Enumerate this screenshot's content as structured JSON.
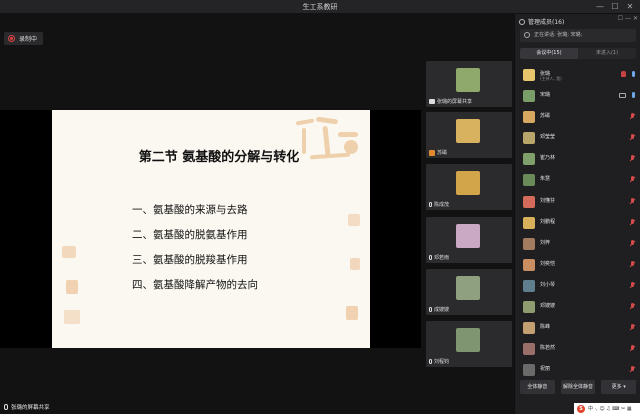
{
  "window": {
    "title": "生工系教研",
    "controls": {
      "minimize": "—",
      "maximize": "☐",
      "close": "✕"
    }
  },
  "recording": {
    "label": "录制中"
  },
  "slide": {
    "title": "第二节  氨基酸的分解与转化",
    "items": [
      "一、氨基酸的来源与去路",
      "二、氨基酸的脱氨基作用",
      "三、氨基酸的脱羧基作用",
      "四、氨基酸降解产物的去向"
    ],
    "watermark": "吉祥如意"
  },
  "share_label": "张璐的屏幕共享",
  "tiles": [
    {
      "name": "张璐的屏幕共享",
      "color": "#8fa86c",
      "badge": "screen"
    },
    {
      "name": "苏磁",
      "color": "#d9b25f",
      "badge": "host"
    },
    {
      "name": "陈成茂",
      "color": "#d2a54a",
      "badge": "none"
    },
    {
      "name": "邓若雨",
      "color": "#c9a9c4",
      "badge": "none"
    },
    {
      "name": "成嫂嫂",
      "color": "#8ea07f",
      "badge": "none"
    },
    {
      "name": "刘程钧",
      "color": "#7f9470",
      "badge": "none"
    }
  ],
  "panel": {
    "title": "管理成员(16)",
    "search_placeholder": "正在讲话: 张璐; 宋璐;",
    "tabs": [
      "会议中(15)",
      "未进入(1)"
    ],
    "participants": [
      {
        "name": "张璐",
        "sub": "(主持人, 我)",
        "color": "#e7c56b",
        "icons": [
          "hand",
          "mic-on"
        ]
      },
      {
        "name": "宋璐",
        "sub": "",
        "color": "#7a9e6a",
        "icons": [
          "cam",
          "mic-on"
        ]
      },
      {
        "name": "苏磁",
        "sub": "",
        "color": "#d8a860",
        "icons": [
          "mic-off"
        ]
      },
      {
        "name": "邓莹莹",
        "sub": "",
        "color": "#b7a56a",
        "icons": [
          "mic-off"
        ]
      },
      {
        "name": "崔乃林",
        "sub": "",
        "color": "#7fa06a",
        "icons": [
          "mic-off"
        ]
      },
      {
        "name": "朱慧",
        "sub": "",
        "color": "#6b8a5a",
        "icons": [
          "mic-off"
        ]
      },
      {
        "name": "刘懂芬",
        "sub": "",
        "color": "#d46a5a",
        "icons": [
          "mic-off"
        ]
      },
      {
        "name": "刘鹏程",
        "sub": "",
        "color": "#d8b05a",
        "icons": [
          "mic-off"
        ]
      },
      {
        "name": "刘梓",
        "sub": "",
        "color": "#a37b5f",
        "icons": [
          "mic-off"
        ]
      },
      {
        "name": "刘奕恺",
        "sub": "",
        "color": "#c98f63",
        "icons": [
          "mic-off"
        ]
      },
      {
        "name": "刘小琴",
        "sub": "",
        "color": "#5f7f8e",
        "icons": [
          "mic-off"
        ]
      },
      {
        "name": "邓嫂嫂",
        "sub": "",
        "color": "#8e9c6f",
        "icons": [
          "mic-off"
        ]
      },
      {
        "name": "陈峰",
        "sub": "",
        "color": "#c2a071",
        "icons": [
          "mic-off"
        ]
      },
      {
        "name": "陈若然",
        "sub": "",
        "color": "#9a6f6a",
        "icons": [
          "mic-off"
        ]
      },
      {
        "name": "祝丽",
        "sub": "",
        "color": "#6a6a6a",
        "icons": [
          "mic-off"
        ]
      }
    ],
    "footer_buttons": [
      "全体静音",
      "解除全体静音",
      "更多 ▾"
    ]
  },
  "ime": {
    "logo": "S",
    "text": "中 ·, ☺ ♫ ⌨ ✂ ▦"
  },
  "colors": {
    "accent": "#6fa6e8",
    "muted": "#d24a4a",
    "record": "#e04343"
  }
}
